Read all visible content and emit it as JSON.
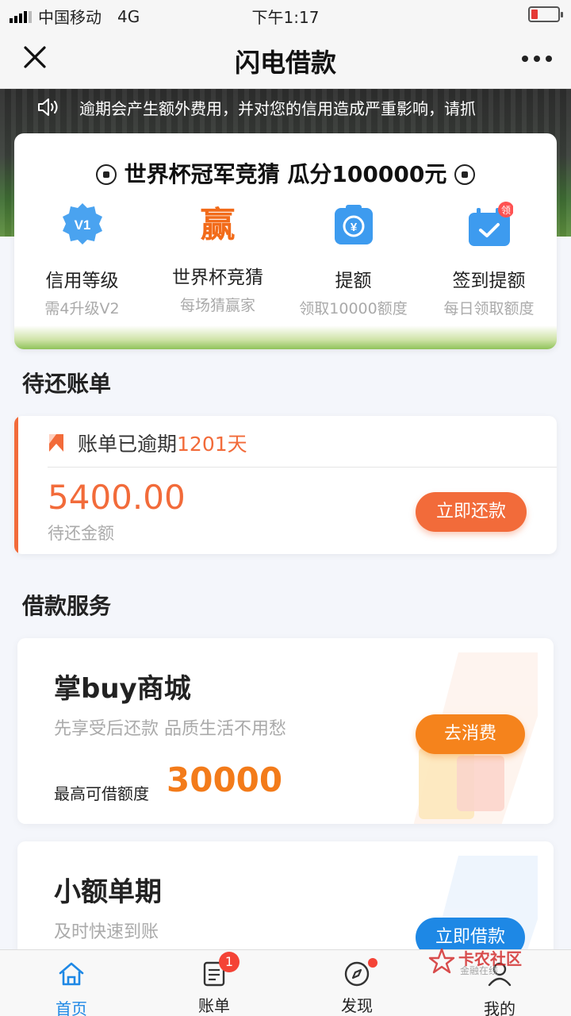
{
  "status_bar": {
    "carrier": "中国移动",
    "network": "4G",
    "time": "下午1:17"
  },
  "nav": {
    "title": "闪电借款"
  },
  "notice": {
    "text": "逾期会产生额外费用，并对您的信用造成严重影响，请抓"
  },
  "promo": {
    "title": "世界杯冠军竞猜 瓜分100000元",
    "items": [
      {
        "label": "信用等级",
        "sub": "需4升级V2",
        "icon": "v1-badge-icon",
        "icon_text": "V1"
      },
      {
        "label": "世界杯竞猜",
        "sub": "每场猜赢家",
        "icon": "win-char-icon",
        "icon_text": "赢"
      },
      {
        "label": "提额",
        "sub": "领取10000额度",
        "icon": "limit-raise-icon",
        "icon_text": "¥"
      },
      {
        "label": "签到提额",
        "sub": "每日领取额度",
        "icon": "checkin-calendar-icon",
        "icon_text": "领"
      }
    ]
  },
  "pending_bills": {
    "section_title": "待还账单",
    "status_prefix": "账单已逾期",
    "overdue_days": "1201天",
    "amount": "5400.00",
    "amount_label": "待还金额",
    "repay_button": "立即还款"
  },
  "services": {
    "section_title": "借款服务",
    "cards": [
      {
        "title": "掌buy商城",
        "desc": "先享受后还款 品质生活不用愁",
        "limit_label": "最高可借额度",
        "limit_value": "30000",
        "button": "去消费"
      },
      {
        "title": "小额单期",
        "desc": "及时快速到账",
        "button": "立即借款"
      }
    ]
  },
  "tabbar": {
    "tabs": [
      {
        "label": "首页",
        "icon": "home-icon",
        "active": true
      },
      {
        "label": "账单",
        "icon": "bill-icon",
        "badge": "1"
      },
      {
        "label": "发现",
        "icon": "compass-icon",
        "dot": true
      },
      {
        "label": "我的",
        "icon": "user-icon"
      }
    ]
  },
  "watermark": {
    "text": "卡农社区",
    "sub": "金融在线"
  },
  "colors": {
    "accent_orange": "#f26b3a",
    "amount_orange": "#f37b1a",
    "button_orange": "#f5831c",
    "primary_blue": "#1e88e5"
  }
}
